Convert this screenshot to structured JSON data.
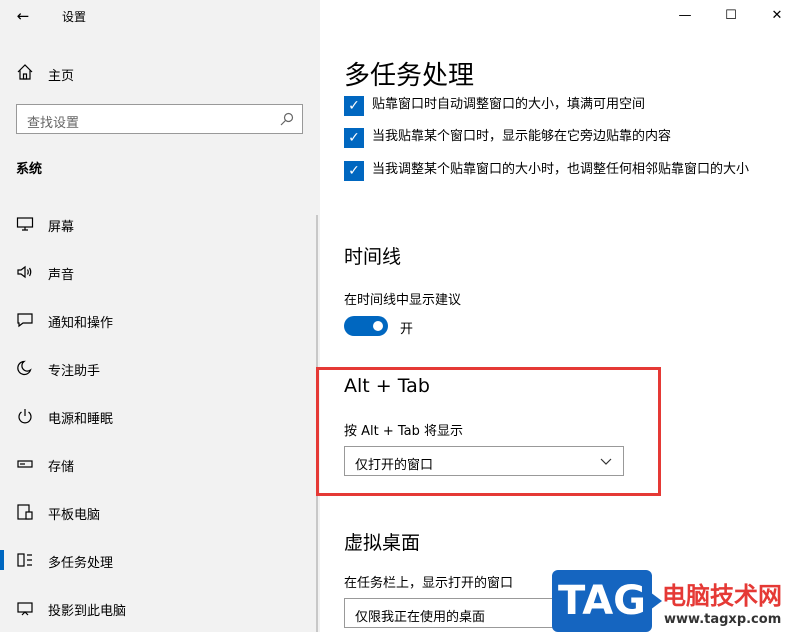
{
  "window": {
    "title": "设置",
    "minimize": "—",
    "maximize": "☐",
    "close": "✕"
  },
  "sidebar": {
    "back": "←",
    "home_label": "主页",
    "search_placeholder": "查找设置",
    "section_title": "系统",
    "items": [
      {
        "label": "屏幕",
        "icon": "display-icon"
      },
      {
        "label": "声音",
        "icon": "speaker-icon"
      },
      {
        "label": "通知和操作",
        "icon": "notification-icon"
      },
      {
        "label": "专注助手",
        "icon": "moon-icon"
      },
      {
        "label": "电源和睡眠",
        "icon": "power-icon"
      },
      {
        "label": "存储",
        "icon": "storage-icon"
      },
      {
        "label": "平板电脑",
        "icon": "tablet-icon"
      },
      {
        "label": "多任务处理",
        "icon": "multitask-icon",
        "active": true
      },
      {
        "label": "投影到此电脑",
        "icon": "project-icon"
      }
    ]
  },
  "main": {
    "title": "多任务处理",
    "snap_options": [
      {
        "label": "贴靠窗口时自动调整窗口的大小，填满可用空间",
        "checked": true
      },
      {
        "label": "当我贴靠某个窗口时，显示能够在它旁边贴靠的内容",
        "checked": true
      },
      {
        "label": "当我调整某个贴靠窗口的大小时，也调整任何相邻贴靠窗口的大小",
        "checked": true
      }
    ],
    "timeline": {
      "heading": "时间线",
      "label": "在时间线中显示建议",
      "toggle_state": "开"
    },
    "alt_tab": {
      "heading": "Alt + Tab",
      "label": "按 Alt + Tab 将显示",
      "selected": "仅打开的窗口"
    },
    "virtual_desktops": {
      "heading": "虚拟桌面",
      "label": "在任务栏上，显示打开的窗口",
      "selected": "仅限我正在使用的桌面"
    }
  },
  "watermark": {
    "logo": "TAG",
    "site_name": "电脑技术网",
    "url": "www.tagxp.com"
  },
  "colors": {
    "accent": "#0067c0",
    "highlight": "#e53935",
    "sidebar_bg": "#f2f2f2"
  }
}
